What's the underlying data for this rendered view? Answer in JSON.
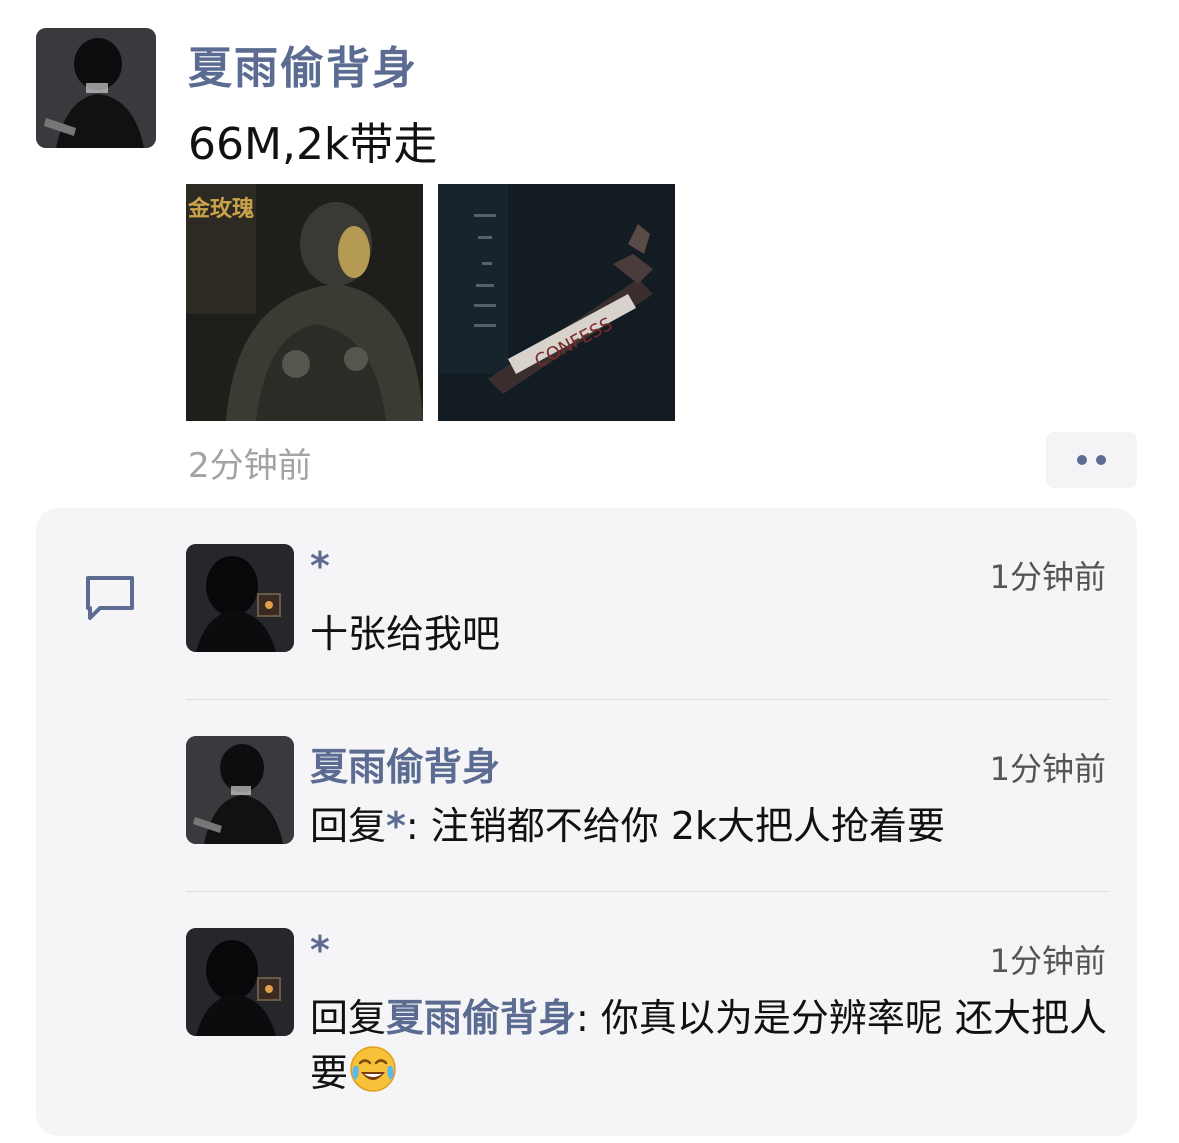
{
  "post": {
    "author": "夏雨偷背身",
    "text": "66M,2k带走",
    "time": "2分钟前",
    "thumbnails": [
      {
        "name": "image-1",
        "caption_fragment": "金玫瑰"
      },
      {
        "name": "image-2",
        "caption_fragment": "CONFESS"
      }
    ],
    "more_icon": "more-dots-icon"
  },
  "comments": [
    {
      "author": "*",
      "time": "1分钟前",
      "reply_prefix": "",
      "reply_to": "",
      "text": "十张给我吧"
    },
    {
      "author": "夏雨偷背身",
      "time": "1分钟前",
      "reply_prefix": "回复",
      "reply_to": "*",
      "text": ": 注销都不给你 2k大把人抢着要"
    },
    {
      "author": "*",
      "time": "1分钟前",
      "reply_prefix": "回复",
      "reply_to": "夏雨偷背身",
      "text": ": 你真以为是分辨率呢 还大把人要"
    }
  ],
  "colors": {
    "name_link": "#5b6b92",
    "meta_gray": "#a3a3a3",
    "comment_bg": "#f5f5f7"
  },
  "icons": {
    "comment": "comment-bubble-icon",
    "emoji": "laughing-crying-emoji-icon"
  }
}
